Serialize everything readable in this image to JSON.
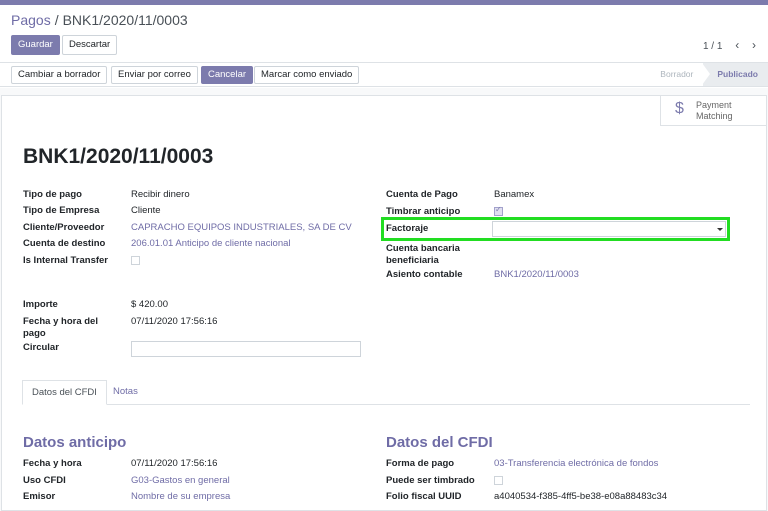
{
  "breadcrumb": {
    "parent": "Pagos",
    "separator": "/",
    "current": "BNK1/2020/11/0003"
  },
  "buttons": {
    "save": "Guardar",
    "discard": "Descartar"
  },
  "pager": {
    "value": "1 / 1",
    "prev": "‹",
    "next": "›"
  },
  "actions": {
    "reset_draft": "Cambiar a borrador",
    "send_email": "Enviar por correo",
    "cancel": "Cancelar",
    "mark_sent": "Marcar como enviado"
  },
  "status": {
    "stages": [
      "Borrador",
      "Publicado"
    ],
    "active": "Publicado"
  },
  "button_box": {
    "icon": "dollar-icon",
    "symbol": "$",
    "line1": "Payment",
    "line2": "Matching"
  },
  "record_title": "BNK1/2020/11/0003",
  "left_fields": {
    "payment_type": {
      "label": "Tipo de pago",
      "value": "Recibir dinero"
    },
    "partner_type": {
      "label": "Tipo de Empresa",
      "value": "Cliente"
    },
    "partner": {
      "label": "Cliente/Proveedor",
      "value": "CAPRACHO EQUIPOS INDUSTRIALES, SA DE CV"
    },
    "destination_account": {
      "label": "Cuenta de destino",
      "value": "206.01.01 Anticipo de cliente nacional"
    },
    "internal_transfer": {
      "label": "Is Internal Transfer",
      "checked": false
    }
  },
  "right_fields": {
    "journal": {
      "label": "Cuenta de Pago",
      "value": "Banamex"
    },
    "stamp_advance": {
      "label": "Timbrar anticipo",
      "checked": true
    },
    "factoring": {
      "label": "Factoraje",
      "value": ""
    },
    "bank_account": {
      "label1": "Cuenta bancaria",
      "label2": "beneficiaria",
      "value": ""
    },
    "journal_entry": {
      "label": "Asiento contable",
      "value": "BNK1/2020/11/0003"
    }
  },
  "amount_fields": {
    "amount": {
      "label": "Importe",
      "value": "$ 420.00"
    },
    "datetime": {
      "label1": "Fecha y hora del",
      "label2": "pago",
      "value": "07/11/2020 17:56:16"
    },
    "memo": {
      "label": "Circular",
      "value": ""
    }
  },
  "tabs": [
    "Datos del CFDI",
    "Notas"
  ],
  "sections": {
    "left_title": "Datos anticipo",
    "left": [
      {
        "label": "Fecha y hora",
        "value": "07/11/2020 17:56:16",
        "link": false
      },
      {
        "label": "Uso CFDI",
        "value": "G03-Gastos en general",
        "link": true
      },
      {
        "label": "Emisor",
        "value": "Nombre de su empresa",
        "link": true
      }
    ],
    "right_title": "Datos del CFDI",
    "right": [
      {
        "label": "Forma de pago",
        "value": "03-Transferencia electrónica de fondos",
        "link": true
      },
      {
        "label": "Puede ser timbrado",
        "checked": false
      },
      {
        "label": "Folio fiscal UUID",
        "value": "a4040534-f385-4ff5-be38-e08a88483c34",
        "link": false
      }
    ]
  },
  "colors": {
    "brand": "#7c7bad",
    "link": "#6f6ca6",
    "highlight": "#22dd22"
  }
}
